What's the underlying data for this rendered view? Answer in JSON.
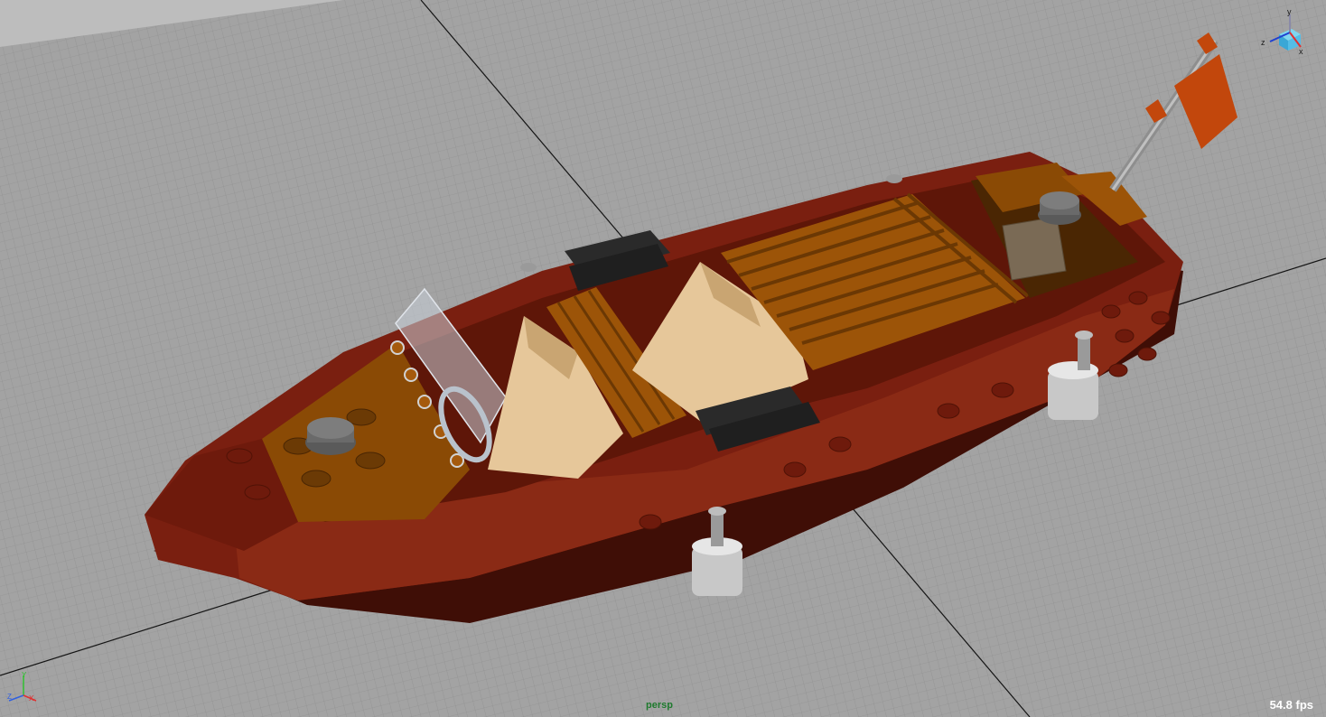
{
  "viewport": {
    "camera_name": "persp",
    "fps": "54.8 fps",
    "background_color": "#a0a0a0",
    "grid_color": "#8a8a8a",
    "axis_line_color": "#111111"
  },
  "view_cube": {
    "axis_labels": {
      "y": "y",
      "z": "z",
      "x": "x"
    },
    "icon": "view-cube-icon"
  },
  "axis_triad": {
    "axis_labels": {
      "y": "Y",
      "z": "Z",
      "x": "X"
    },
    "colors": {
      "x": "#e03030",
      "y": "#30c030",
      "z": "#3060e0"
    }
  },
  "model": {
    "hull_color": "#7a1f10",
    "deck_color": "#8a4a05",
    "seat_color": "#e6c79a",
    "cargo_color": "#9c5408",
    "rail_color": "#2a2a2a",
    "flag_color": "#c2470c",
    "fitting_color": "#c8c8c8"
  }
}
